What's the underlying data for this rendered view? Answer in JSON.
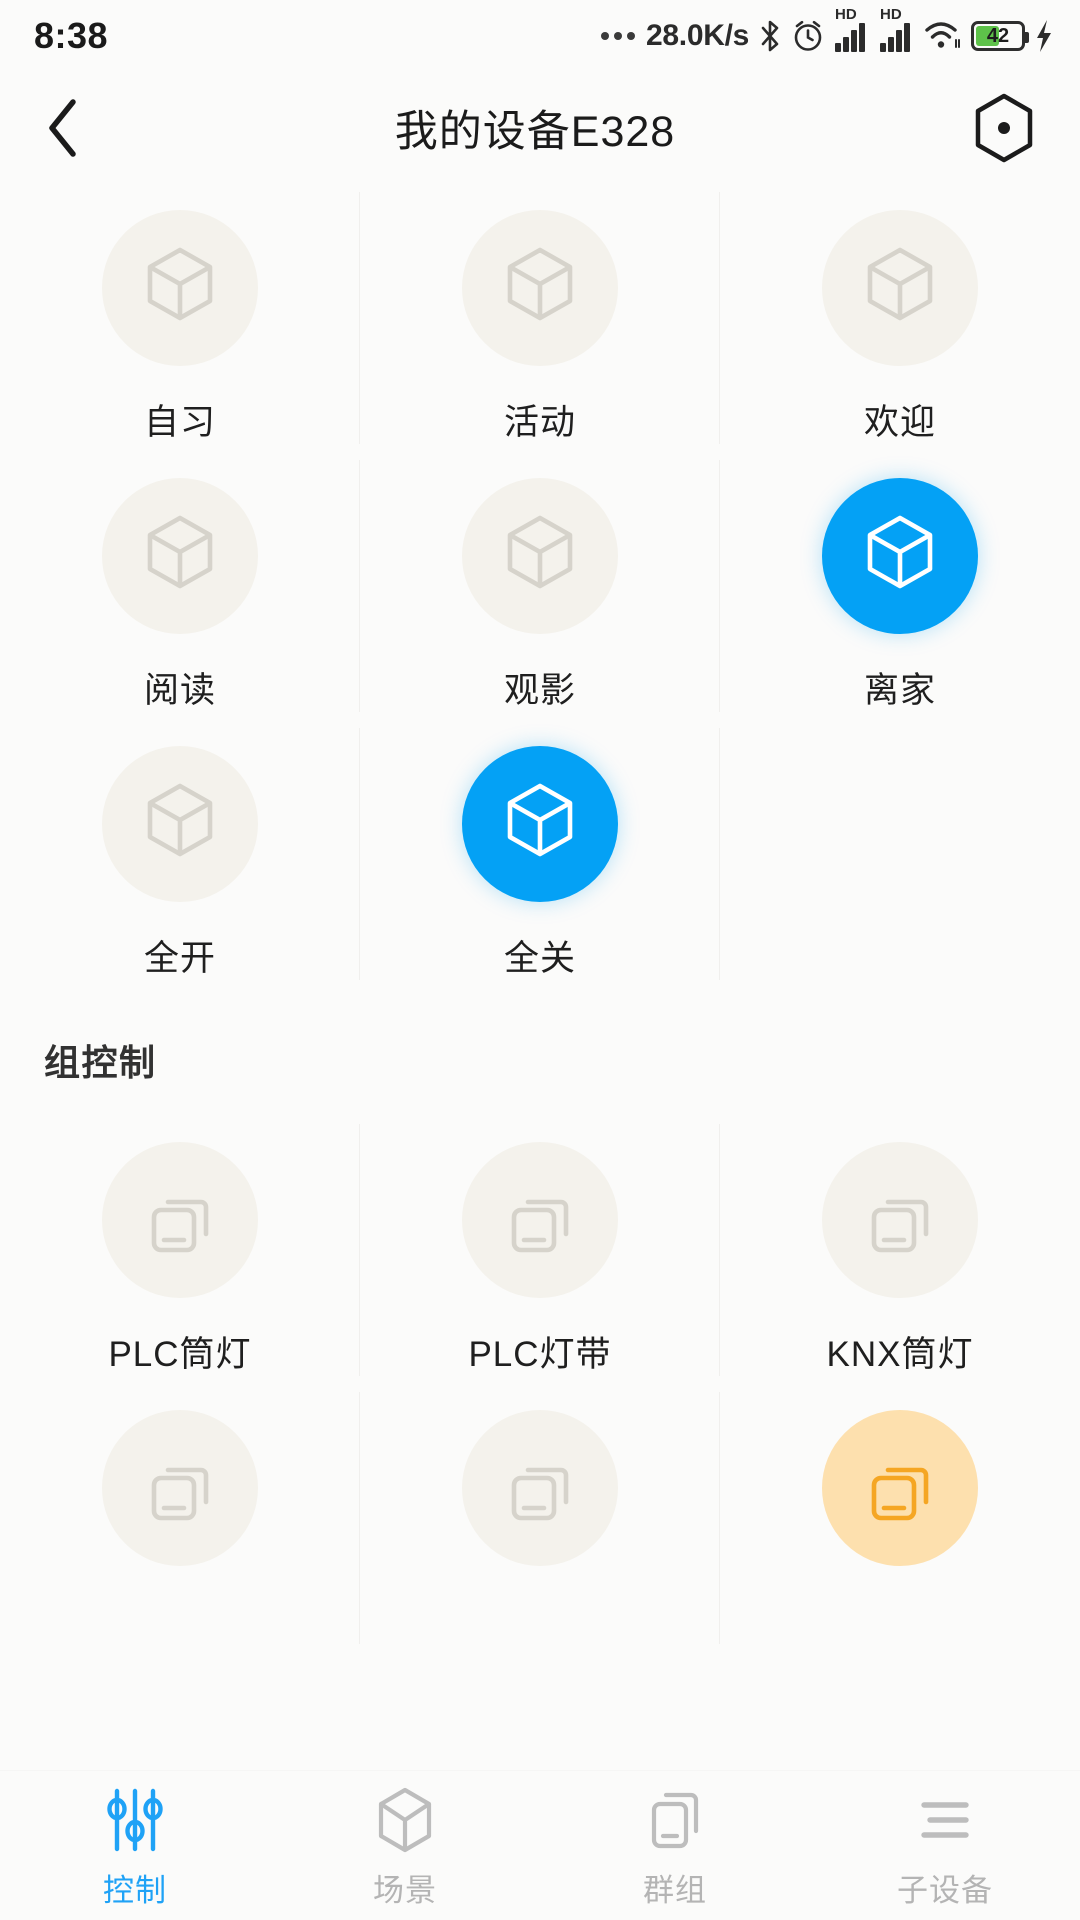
{
  "status_bar": {
    "time": "8:38",
    "network_speed": "28.0K/s",
    "battery_percent": "42",
    "icons": [
      "dots-icon",
      "bluetooth-icon",
      "alarm-clock-icon",
      "hd-signal-icon-1",
      "hd-signal-icon-2",
      "wifi-icon",
      "battery-icon",
      "charging-bolt-icon"
    ],
    "hd_label_1": "HD",
    "hd_label_2": "HD"
  },
  "app_bar": {
    "back_icon": "chevron-left-icon",
    "title": "我的设备E328",
    "action_icon": "hexagon-dot-icon"
  },
  "scenes": {
    "items": [
      {
        "label": "自习",
        "icon": "cube-icon",
        "state": "idle"
      },
      {
        "label": "活动",
        "icon": "cube-icon",
        "state": "idle"
      },
      {
        "label": "欢迎",
        "icon": "cube-icon",
        "state": "idle"
      },
      {
        "label": "阅读",
        "icon": "cube-icon",
        "state": "idle"
      },
      {
        "label": "观影",
        "icon": "cube-icon",
        "state": "idle"
      },
      {
        "label": "离家",
        "icon": "cube-icon",
        "state": "active"
      },
      {
        "label": "全开",
        "icon": "cube-icon",
        "state": "idle"
      },
      {
        "label": "全关",
        "icon": "cube-icon",
        "state": "active"
      },
      {
        "label": "",
        "icon": "",
        "state": "empty"
      }
    ]
  },
  "group_section": {
    "title": "组控制",
    "items": [
      {
        "label": "PLC筒灯",
        "icon": "layers-icon",
        "state": "idle"
      },
      {
        "label": "PLC灯带",
        "icon": "layers-icon",
        "state": "idle"
      },
      {
        "label": "KNX筒灯",
        "icon": "layers-icon",
        "state": "idle"
      },
      {
        "label": "",
        "icon": "layers-icon",
        "state": "idle"
      },
      {
        "label": "",
        "icon": "layers-icon",
        "state": "idle"
      },
      {
        "label": "",
        "icon": "layers-icon",
        "state": "amber"
      }
    ]
  },
  "bottom_nav": {
    "items": [
      {
        "label": "控制",
        "icon": "sliders-icon",
        "active": true
      },
      {
        "label": "场景",
        "icon": "cube-icon",
        "active": false
      },
      {
        "label": "群组",
        "icon": "layers-icon",
        "active": false
      },
      {
        "label": "子设备",
        "icon": "list-icon",
        "active": false
      }
    ]
  },
  "colors": {
    "accent": "#04a1f5",
    "nav_accent": "#1fa2f6",
    "bubble_idle": "#f4f2ec",
    "bubble_amber": "#fde0ae",
    "amber_icon": "#f5a623",
    "battery_green": "#5ec24a",
    "background": "#fbfbfa"
  }
}
